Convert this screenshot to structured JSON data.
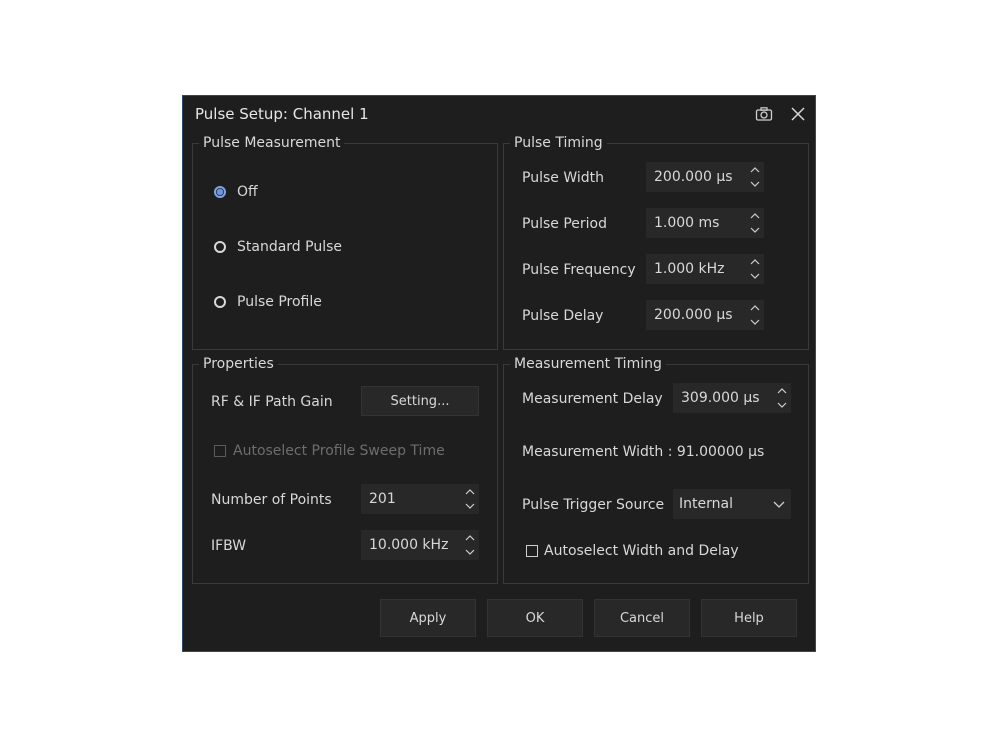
{
  "dialog": {
    "title": "Pulse Setup: Channel 1",
    "icons": [
      "camera-icon",
      "close-icon"
    ]
  },
  "pulse_measurement": {
    "title": "Pulse Measurement",
    "options": [
      {
        "label": "Off",
        "checked": true
      },
      {
        "label": "Standard Pulse",
        "checked": false
      },
      {
        "label": "Pulse Profile",
        "checked": false
      }
    ]
  },
  "pulse_timing": {
    "title": "Pulse Timing",
    "width_label": "Pulse Width",
    "width_value": "200.000 µs",
    "period_label": "Pulse Period",
    "period_value": "1.000 ms",
    "frequency_label": "Pulse Frequency",
    "frequency_value": "1.000 kHz",
    "delay_label": "Pulse Delay",
    "delay_value": "200.000 µs"
  },
  "properties": {
    "title": "Properties",
    "gain_label": "RF & IF Path Gain",
    "setting_button": "Setting...",
    "autoselect_label": "Autoselect Profile Sweep Time",
    "points_label": "Number of Points",
    "points_value": "201",
    "ifbw_label": "IFBW",
    "ifbw_value": "10.000 kHz"
  },
  "measurement_timing": {
    "title": "Measurement Timing",
    "delay_label": "Measurement Delay",
    "delay_value": "309.000 µs",
    "width_text": "Measurement Width :  91.00000 µs",
    "trigger_label": "Pulse Trigger Source",
    "trigger_value": "Internal",
    "autoselect_label": "Autoselect Width and Delay"
  },
  "buttons": {
    "apply": "Apply",
    "ok": "OK",
    "cancel": "Cancel",
    "help": "Help"
  },
  "colors": {
    "background": "#1e1e1e",
    "accent": "#6b95e0",
    "border": "#2f4a66"
  }
}
